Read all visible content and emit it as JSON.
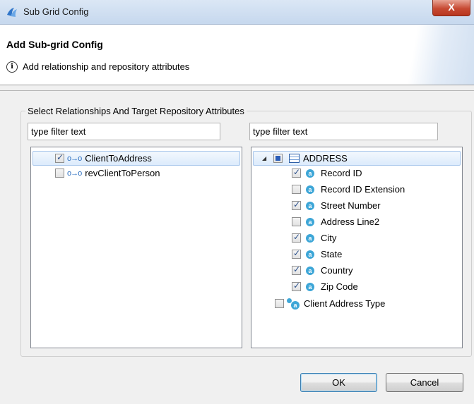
{
  "window": {
    "title": "Sub Grid Config",
    "close_label": "X"
  },
  "header": {
    "heading": "Add Sub-grid Config",
    "info_icon": "i",
    "description": "Add relationship and repository attributes"
  },
  "group": {
    "label": "Select Relationships And Target Repository Attributes"
  },
  "left": {
    "filter_value": "type filter text",
    "items": [
      {
        "label": "ClientToAddress",
        "checked": true
      },
      {
        "label": "revClientToPerson",
        "checked": false
      }
    ]
  },
  "right": {
    "filter_value": "type filter text",
    "root": {
      "label": "ADDRESS",
      "expander": "◢",
      "state": "partial"
    },
    "attributes": [
      {
        "label": "Record ID",
        "checked": true
      },
      {
        "label": "Record ID Extension",
        "checked": false
      },
      {
        "label": "Street Number",
        "checked": true
      },
      {
        "label": "Address Line2",
        "checked": false
      },
      {
        "label": "City",
        "checked": true
      },
      {
        "label": "State",
        "checked": true
      },
      {
        "label": "Country",
        "checked": true
      },
      {
        "label": "Zip Code",
        "checked": true
      }
    ],
    "extra": {
      "label": "Client Address Type",
      "checked": false
    },
    "attr_icon_glyph": "a"
  },
  "buttons": {
    "ok": "OK",
    "cancel": "Cancel"
  },
  "icons": {
    "relationship_icon": "o→o",
    "relationship_icon_name": "relationship-icon",
    "attribute_icon_name": "attribute-icon",
    "table_icon_name": "table-icon"
  }
}
